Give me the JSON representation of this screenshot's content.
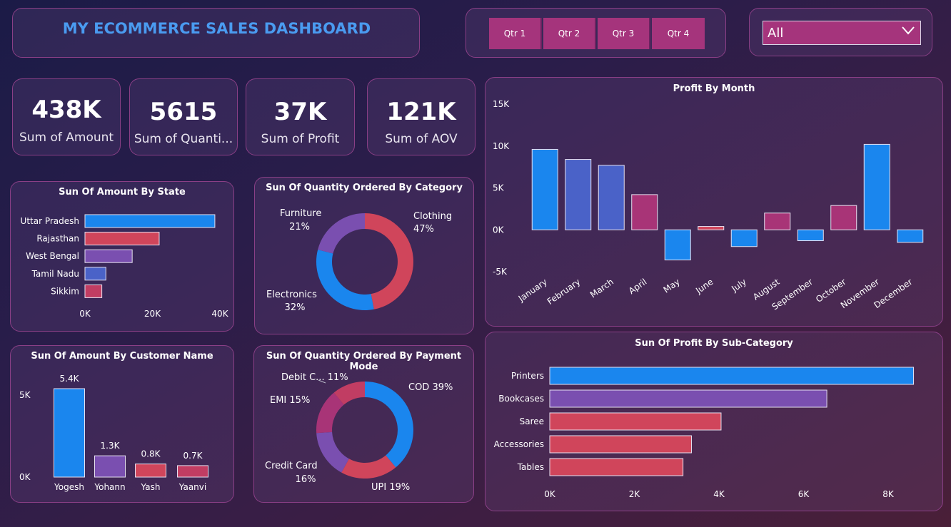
{
  "header": {
    "title": "MY ECOMMERCE SALES DASHBOARD",
    "quarters": [
      "Qtr 1",
      "Qtr 2",
      "Qtr 3",
      "Qtr 4"
    ],
    "filter_value": "All"
  },
  "kpis": [
    {
      "value": "438K",
      "label": "Sum of Amount"
    },
    {
      "value": "5615",
      "label": "Sum of Quanti..."
    },
    {
      "value": "37K",
      "label": "Sum of Profit"
    },
    {
      "value": "121K",
      "label": "Sum of AOV"
    }
  ],
  "colors": {
    "blue": "#1a86ee",
    "red": "#d0455b",
    "purple": "#7a4fb0",
    "indigo": "#4a62c8",
    "magenta": "#a83477"
  },
  "chart_data": [
    {
      "type": "bar",
      "orientation": "horizontal",
      "title": "Sun Of Amount By State",
      "categories": [
        "Uttar Pradesh",
        "Rajasthan",
        "West Bengal",
        "Tamil Nadu",
        "Sikkim"
      ],
      "values": [
        38500,
        22000,
        14000,
        6200,
        5000
      ],
      "xlim": [
        0,
        40000
      ],
      "xticks": [
        "0K",
        "20K",
        "40K"
      ],
      "colors": [
        "#1a86ee",
        "#d0455b",
        "#7a4fb0",
        "#4a62c8",
        "#c13d63"
      ]
    },
    {
      "type": "pie",
      "donut": true,
      "title": "Sun Of Quantity Ordered By Category",
      "categories": [
        "Clothing",
        "Electronics",
        "Furniture"
      ],
      "values": [
        47,
        32,
        21
      ],
      "labels": [
        "47%",
        "32%",
        "21%"
      ],
      "colors": [
        "#d0455b",
        "#1a86ee",
        "#7a4fb0"
      ]
    },
    {
      "type": "bar",
      "title": "Profit By Month",
      "categories": [
        "January",
        "February",
        "March",
        "April",
        "May",
        "June",
        "July",
        "August",
        "September",
        "October",
        "November",
        "December"
      ],
      "values": [
        9600,
        8400,
        7700,
        4200,
        -3600,
        400,
        -2000,
        2000,
        -1300,
        2900,
        10200,
        -1500
      ],
      "ylim": [
        -5000,
        15000
      ],
      "yticks": [
        "-5K",
        "0K",
        "5K",
        "10K",
        "15K"
      ],
      "colors": [
        "#1a86ee",
        "#4a62c8",
        "#4a62c8",
        "#a83477",
        "#1a86ee",
        "#d0455b",
        "#1a86ee",
        "#a83477",
        "#1a86ee",
        "#a83477",
        "#1a86ee",
        "#1a86ee"
      ]
    },
    {
      "type": "bar",
      "title": "Sun Of Amount By Customer Name",
      "categories": [
        "Yogesh",
        "Yohann",
        "Yash",
        "Yaanvi"
      ],
      "values": [
        5400,
        1300,
        800,
        700
      ],
      "data_labels": [
        "5.4K",
        "1.3K",
        "0.8K",
        "0.7K"
      ],
      "ylim": [
        0,
        6000
      ],
      "yticks": [
        "0K",
        "5K"
      ],
      "colors": [
        "#1a86ee",
        "#7a4fb0",
        "#d0455b",
        "#c13d63"
      ]
    },
    {
      "type": "pie",
      "donut": true,
      "title": "Sun Of Quantity Ordered By Payment Mode",
      "categories": [
        "COD",
        "UPI",
        "Credit Card",
        "EMI",
        "Debit C..."
      ],
      "values": [
        39,
        19,
        16,
        15,
        11
      ],
      "labels": [
        "COD 39%",
        "UPI 19%",
        "Credit Card",
        "16%",
        "EMI 15%",
        "Debit C... 11%"
      ],
      "colors": [
        "#1a86ee",
        "#d0455b",
        "#7a4fb0",
        "#a83477",
        "#c13d63"
      ]
    },
    {
      "type": "bar",
      "orientation": "horizontal",
      "title": "Sun Of Profit By Sub-Category",
      "categories": [
        "Printers",
        "Bookcases",
        "Saree",
        "Accessories",
        "Tables"
      ],
      "values": [
        8600,
        6550,
        4050,
        3350,
        3150
      ],
      "xlim": [
        0,
        8000
      ],
      "xticks": [
        "0K",
        "2K",
        "4K",
        "6K",
        "8K"
      ],
      "colors": [
        "#1a86ee",
        "#7a4fb0",
        "#d0455b",
        "#d0455b",
        "#d0455b"
      ]
    }
  ]
}
